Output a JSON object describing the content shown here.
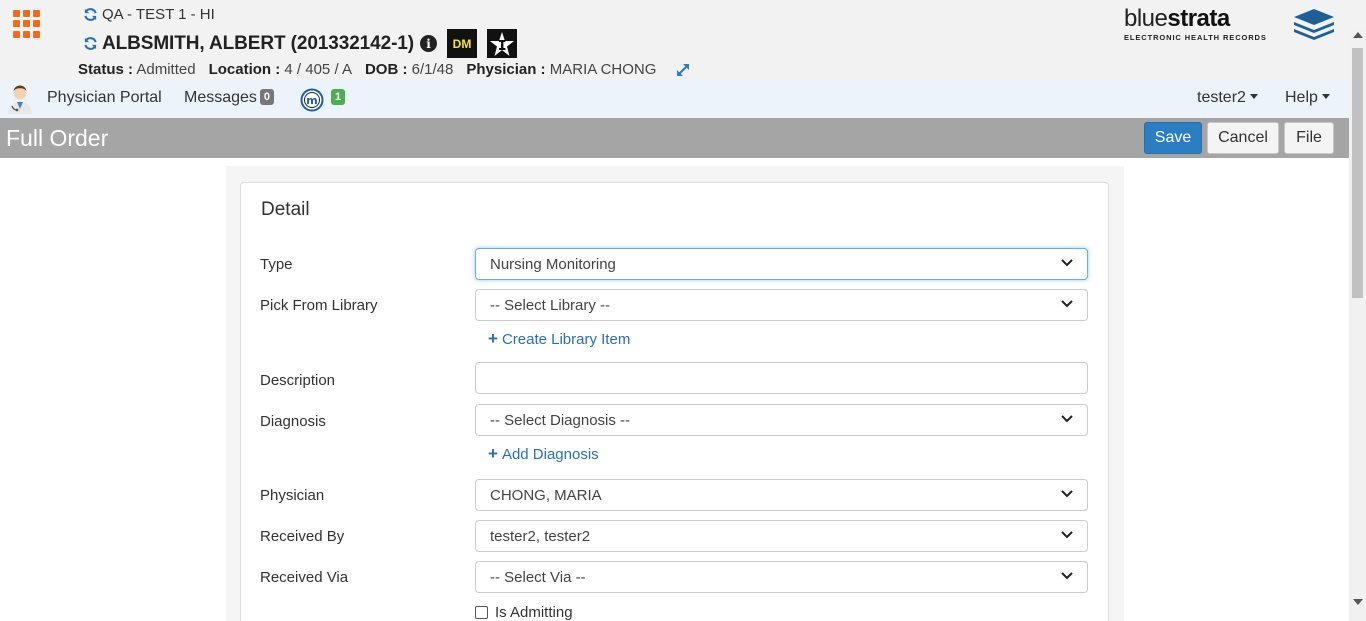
{
  "header": {
    "facility": "QA - TEST 1 - HI",
    "patient_name": "ALBSMITH, ALBERT (201332142-1)",
    "dm_badge": "DM",
    "status_label": "Status :",
    "status_value": "Admitted",
    "location_label": "Location :",
    "location_value": "4 / 405 / A",
    "dob_label": "DOB :",
    "dob_value": "6/1/48",
    "physician_label": "Physician :",
    "physician_value": "MARIA CHONG"
  },
  "logo": {
    "word_light": "blue",
    "word_bold": "strata",
    "subtitle": "ELECTRONIC HEALTH RECORDS"
  },
  "nav": {
    "physician_portal": "Physician Portal",
    "messages_label": "Messages",
    "messages_count": "0",
    "m_count": "1",
    "user_menu": "tester2",
    "help_menu": "Help"
  },
  "titlebar": {
    "title": "Full Order",
    "save": "Save",
    "cancel": "Cancel",
    "file": "File"
  },
  "form": {
    "heading": "Detail",
    "type_label": "Type",
    "type_value": "Nursing Monitoring",
    "library_label": "Pick From Library",
    "library_value": "-- Select Library --",
    "create_library": "Create Library Item",
    "description_label": "Description",
    "description_value": "",
    "diagnosis_label": "Diagnosis",
    "diagnosis_value": "-- Select Diagnosis --",
    "add_diagnosis": "Add Diagnosis",
    "physician_label": "Physician",
    "physician_value": "CHONG, MARIA",
    "received_by_label": "Received By",
    "received_by_value": "tester2, tester2",
    "received_via_label": "Received Via",
    "received_via_value": "-- Select Via --",
    "is_admitting_label": "Is Admitting",
    "is_admitting_checked": false
  },
  "colors": {
    "accent_orange": "#f26b1d",
    "primary_blue": "#2a7ec1",
    "link_blue": "#2a6fb0",
    "titlebar_gray": "#a5a5a5",
    "nav_bg": "#ecf3fb"
  }
}
